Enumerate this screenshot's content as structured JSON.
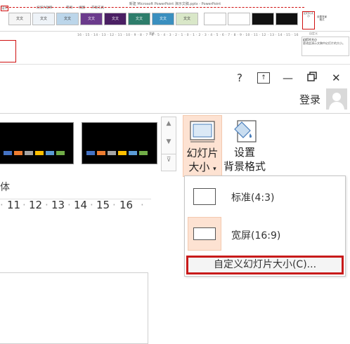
{
  "mini": {
    "title": "新建 Microsoft PowerPoint 演示文稿.pptx - PowerPoint",
    "tabs": [
      "设计",
      "幻灯片放映",
      "审阅",
      "视图",
      "开发工具"
    ],
    "theme_thumb_text": [
      "文文",
      "文文",
      "文文",
      "文文",
      "文文",
      "文文",
      "文文",
      "文文"
    ],
    "variant_label": "变体",
    "ruler": "16 · 15 · 14 · 13 · 12 · 11 · 10 · 9 · 8 · 7 · 6 · 5 · 4 · 3 · 2 · 1 · 0 · 1 · 2 · 3 · 4 · 5 · 6 · 7 · 8 · 9 · 10 · 11 · 12 · 13 · 14 · 15 · 16",
    "slide_size_label": "幻灯片大小",
    "format_bg_label": "设置背景格式",
    "custom_group_label": "自定义",
    "tooltip_title": "幻灯片大小",
    "tooltip_text": "更改此演示文稿中幻灯片的大小。"
  },
  "window": {
    "help": "?",
    "restore_ribbon": "⊼",
    "minimize": "—",
    "restore": "🗗",
    "close": "✕",
    "login": "登录"
  },
  "ribbon": {
    "slide_size_line1": "幻灯片",
    "slide_size_line2": "大小",
    "format_bg_line1": "设置",
    "format_bg_line2": "背景格式",
    "group_label_partial": "体",
    "ruler_numbers": [
      "11",
      "12",
      "13",
      "14",
      "15",
      "16"
    ]
  },
  "dropdown": {
    "standard": "标准(4:3)",
    "widescreen": "宽屏(16:9)",
    "custom": "自定义幻灯片大小(C)..."
  },
  "colors": {
    "highlight_red": "#c81a1a",
    "button_hover": "#fde2d2",
    "swatches": [
      "#4472c4",
      "#ed7d31",
      "#a5a5a5",
      "#ffc000",
      "#5b9bd5",
      "#70ad47"
    ]
  }
}
